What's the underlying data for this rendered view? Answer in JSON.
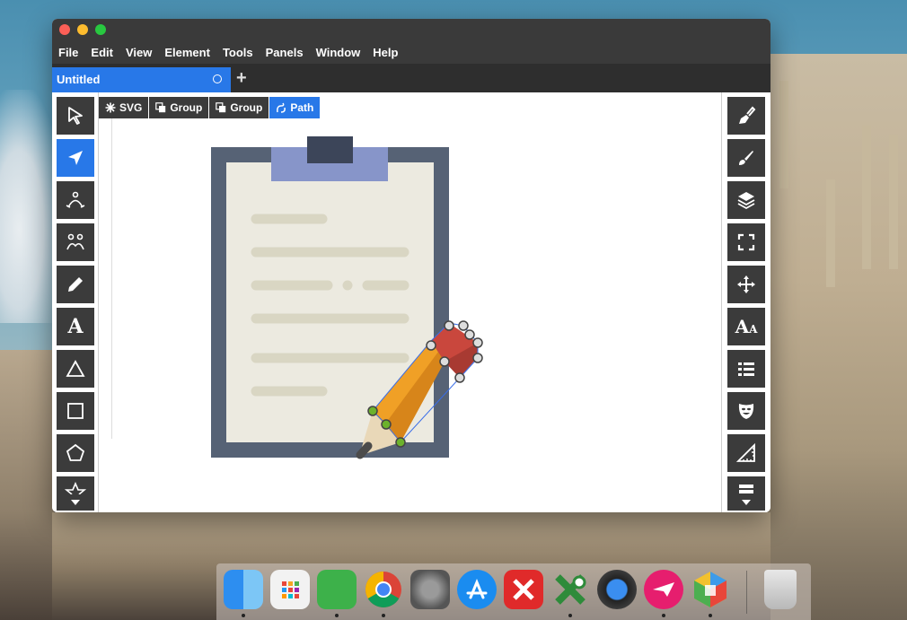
{
  "menu": [
    "File",
    "Edit",
    "View",
    "Element",
    "Tools",
    "Panels",
    "Window",
    "Help"
  ],
  "tab": {
    "title": "Untitled",
    "add_icon": "plus-icon"
  },
  "breadcrumb": [
    {
      "label": "SVG",
      "icon": "asterisk-icon"
    },
    {
      "label": "Group",
      "icon": "group-icon"
    },
    {
      "label": "Group",
      "icon": "group-icon"
    },
    {
      "label": "Path",
      "icon": "path-icon",
      "active": true
    }
  ],
  "left_tools": [
    "select-arrow-icon",
    "node-arrow-icon",
    "pen-icon",
    "spiro-icon",
    "pencil-icon",
    "text-icon",
    "triangle-icon",
    "rectangle-icon",
    "pentagon-icon",
    "star-icon"
  ],
  "right_tools": [
    "fill-stroke-icon",
    "brush-icon",
    "layers-icon",
    "fullscreen-icon",
    "move-icon",
    "typography-icon",
    "list-icon",
    "masks-icon",
    "ruler-icon",
    "more-icon"
  ],
  "left_text_tool_glyph": "A",
  "right_text_tool_glyph": "A",
  "colors": {
    "accent": "#2878e8",
    "tool_bg": "#3b3b3b",
    "menubar": "#3a3a3a"
  },
  "dock": [
    "finder-icon",
    "launchpad-icon",
    "evernote-icon",
    "chrome-icon",
    "system-preferences-icon",
    "app-store-icon",
    "xmind-icon",
    "crossover-icon",
    "quicktime-icon",
    "airmail-icon",
    "boxy-svg-icon",
    "trash-icon"
  ]
}
